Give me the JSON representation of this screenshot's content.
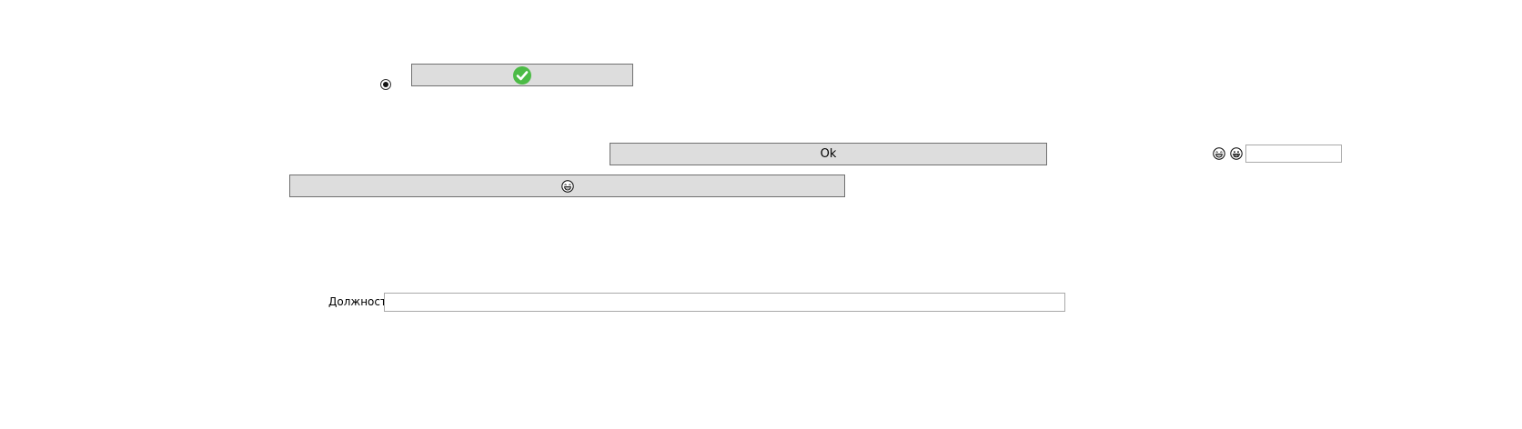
{
  "buttons": {
    "ok_label": "Ok"
  },
  "icons": {
    "check": "check-circle-icon",
    "emoji_laugh": "laughing-face-icon",
    "emoji_grin": "grinning-face-icon"
  },
  "colors": {
    "button_bg": "#dddddd",
    "button_border": "#707070",
    "check_green": "#4cbb46"
  },
  "form": {
    "position_label": "Должность",
    "position_value": "",
    "side_input_value": ""
  },
  "radio": {
    "selected": true
  }
}
